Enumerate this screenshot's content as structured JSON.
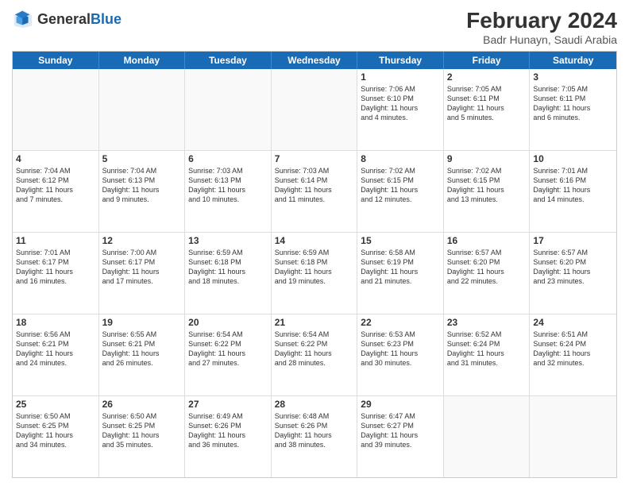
{
  "header": {
    "logo_general": "General",
    "logo_blue": "Blue",
    "month_year": "February 2024",
    "location": "Badr Hunayn, Saudi Arabia"
  },
  "days_of_week": [
    "Sunday",
    "Monday",
    "Tuesday",
    "Wednesday",
    "Thursday",
    "Friday",
    "Saturday"
  ],
  "weeks": [
    [
      {
        "day": "",
        "info": ""
      },
      {
        "day": "",
        "info": ""
      },
      {
        "day": "",
        "info": ""
      },
      {
        "day": "",
        "info": ""
      },
      {
        "day": "1",
        "info": "Sunrise: 7:06 AM\nSunset: 6:10 PM\nDaylight: 11 hours\nand 4 minutes."
      },
      {
        "day": "2",
        "info": "Sunrise: 7:05 AM\nSunset: 6:11 PM\nDaylight: 11 hours\nand 5 minutes."
      },
      {
        "day": "3",
        "info": "Sunrise: 7:05 AM\nSunset: 6:11 PM\nDaylight: 11 hours\nand 6 minutes."
      }
    ],
    [
      {
        "day": "4",
        "info": "Sunrise: 7:04 AM\nSunset: 6:12 PM\nDaylight: 11 hours\nand 7 minutes."
      },
      {
        "day": "5",
        "info": "Sunrise: 7:04 AM\nSunset: 6:13 PM\nDaylight: 11 hours\nand 9 minutes."
      },
      {
        "day": "6",
        "info": "Sunrise: 7:03 AM\nSunset: 6:13 PM\nDaylight: 11 hours\nand 10 minutes."
      },
      {
        "day": "7",
        "info": "Sunrise: 7:03 AM\nSunset: 6:14 PM\nDaylight: 11 hours\nand 11 minutes."
      },
      {
        "day": "8",
        "info": "Sunrise: 7:02 AM\nSunset: 6:15 PM\nDaylight: 11 hours\nand 12 minutes."
      },
      {
        "day": "9",
        "info": "Sunrise: 7:02 AM\nSunset: 6:15 PM\nDaylight: 11 hours\nand 13 minutes."
      },
      {
        "day": "10",
        "info": "Sunrise: 7:01 AM\nSunset: 6:16 PM\nDaylight: 11 hours\nand 14 minutes."
      }
    ],
    [
      {
        "day": "11",
        "info": "Sunrise: 7:01 AM\nSunset: 6:17 PM\nDaylight: 11 hours\nand 16 minutes."
      },
      {
        "day": "12",
        "info": "Sunrise: 7:00 AM\nSunset: 6:17 PM\nDaylight: 11 hours\nand 17 minutes."
      },
      {
        "day": "13",
        "info": "Sunrise: 6:59 AM\nSunset: 6:18 PM\nDaylight: 11 hours\nand 18 minutes."
      },
      {
        "day": "14",
        "info": "Sunrise: 6:59 AM\nSunset: 6:18 PM\nDaylight: 11 hours\nand 19 minutes."
      },
      {
        "day": "15",
        "info": "Sunrise: 6:58 AM\nSunset: 6:19 PM\nDaylight: 11 hours\nand 21 minutes."
      },
      {
        "day": "16",
        "info": "Sunrise: 6:57 AM\nSunset: 6:20 PM\nDaylight: 11 hours\nand 22 minutes."
      },
      {
        "day": "17",
        "info": "Sunrise: 6:57 AM\nSunset: 6:20 PM\nDaylight: 11 hours\nand 23 minutes."
      }
    ],
    [
      {
        "day": "18",
        "info": "Sunrise: 6:56 AM\nSunset: 6:21 PM\nDaylight: 11 hours\nand 24 minutes."
      },
      {
        "day": "19",
        "info": "Sunrise: 6:55 AM\nSunset: 6:21 PM\nDaylight: 11 hours\nand 26 minutes."
      },
      {
        "day": "20",
        "info": "Sunrise: 6:54 AM\nSunset: 6:22 PM\nDaylight: 11 hours\nand 27 minutes."
      },
      {
        "day": "21",
        "info": "Sunrise: 6:54 AM\nSunset: 6:22 PM\nDaylight: 11 hours\nand 28 minutes."
      },
      {
        "day": "22",
        "info": "Sunrise: 6:53 AM\nSunset: 6:23 PM\nDaylight: 11 hours\nand 30 minutes."
      },
      {
        "day": "23",
        "info": "Sunrise: 6:52 AM\nSunset: 6:24 PM\nDaylight: 11 hours\nand 31 minutes."
      },
      {
        "day": "24",
        "info": "Sunrise: 6:51 AM\nSunset: 6:24 PM\nDaylight: 11 hours\nand 32 minutes."
      }
    ],
    [
      {
        "day": "25",
        "info": "Sunrise: 6:50 AM\nSunset: 6:25 PM\nDaylight: 11 hours\nand 34 minutes."
      },
      {
        "day": "26",
        "info": "Sunrise: 6:50 AM\nSunset: 6:25 PM\nDaylight: 11 hours\nand 35 minutes."
      },
      {
        "day": "27",
        "info": "Sunrise: 6:49 AM\nSunset: 6:26 PM\nDaylight: 11 hours\nand 36 minutes."
      },
      {
        "day": "28",
        "info": "Sunrise: 6:48 AM\nSunset: 6:26 PM\nDaylight: 11 hours\nand 38 minutes."
      },
      {
        "day": "29",
        "info": "Sunrise: 6:47 AM\nSunset: 6:27 PM\nDaylight: 11 hours\nand 39 minutes."
      },
      {
        "day": "",
        "info": ""
      },
      {
        "day": "",
        "info": ""
      }
    ]
  ]
}
